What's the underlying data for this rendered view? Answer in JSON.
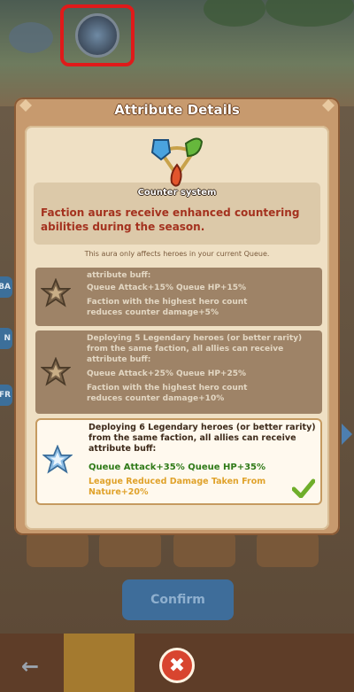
{
  "modal": {
    "title": "Attribute Details",
    "system_label": "Counter system",
    "description": "Faction auras receive enhanced countering abilities during the season.",
    "note": "This aura only affects heroes in your current Queue.",
    "tiers": [
      {
        "lines": [
          "attribute buff:",
          "Queue Attack+15% Queue HP+15%",
          "Faction with the highest hero count",
          "reduces counter damage+5%"
        ],
        "active": false
      },
      {
        "lines": [
          "Deploying 5 Legendary heroes (or better rarity)",
          "from the same faction, all allies can receive",
          "attribute buff:",
          "Queue Attack+25% Queue HP+25%",
          "Faction with the highest hero count",
          "reduces counter damage+10%"
        ],
        "active": false
      },
      {
        "intro": "Deploying 6 Legendary heroes (or better rarity) from the same faction, all allies can receive attribute buff:",
        "buff": "Queue Attack+35% Queue HP+35%",
        "bonus": "League Reduced Damage Taken From Nature+20%",
        "active": true
      }
    ]
  },
  "background": {
    "confirm_label": "Confirm",
    "side_chips": [
      "BA",
      "N",
      "FR"
    ],
    "back_icon": "back-arrow-icon"
  },
  "close_icon": "close-x-icon",
  "colors": {
    "highlight": "#e01a1a",
    "description": "#a4321f",
    "buff_green": "#2f7a18",
    "bonus_orange": "#e0a22a",
    "close_red": "#d8452f"
  }
}
